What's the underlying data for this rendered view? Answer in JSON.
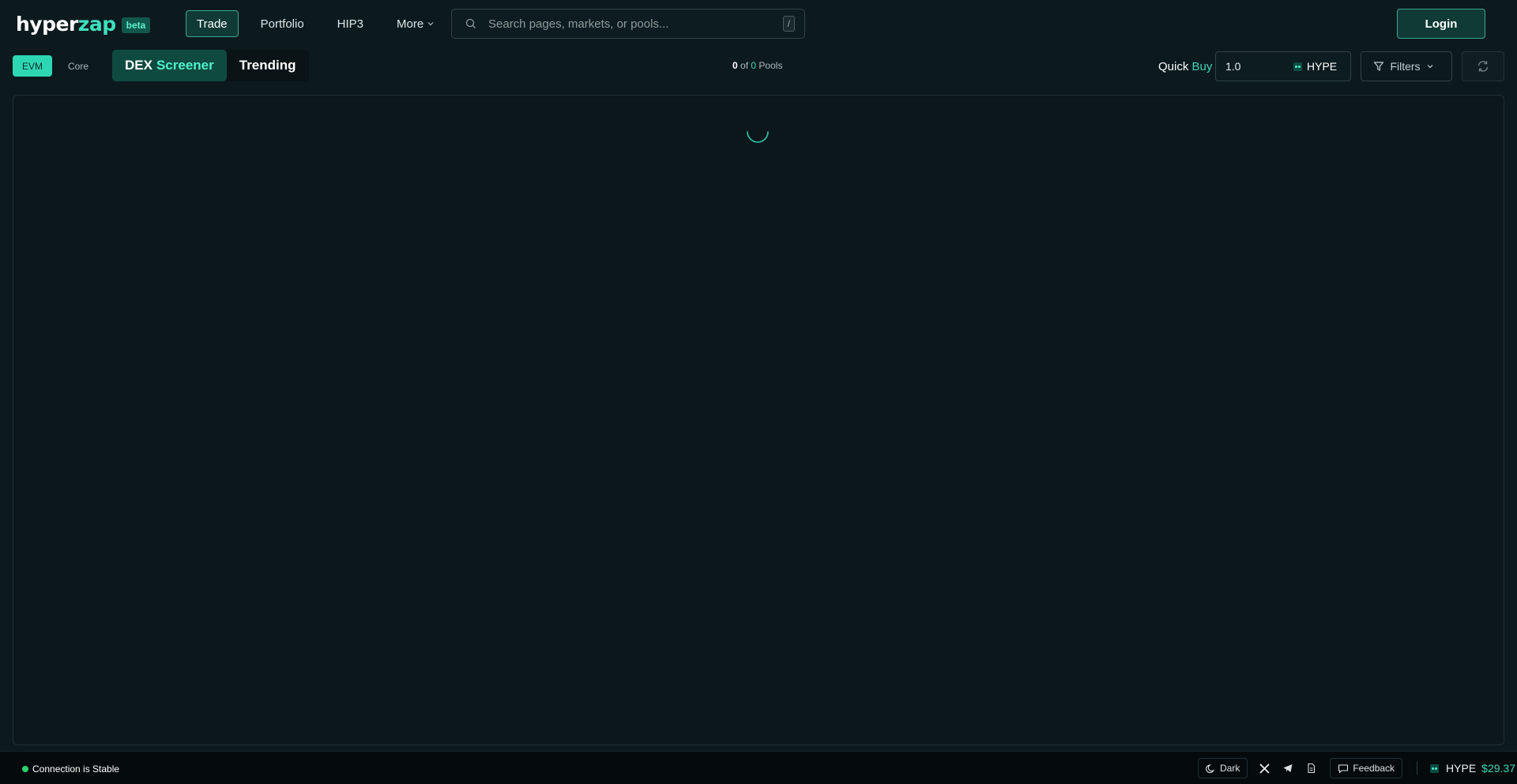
{
  "app": {
    "logo_main": "hyper",
    "logo_accent": "zap",
    "badge": "beta"
  },
  "nav": {
    "items": [
      {
        "label": "Trade",
        "active": true
      },
      {
        "label": "Portfolio"
      },
      {
        "label": "HIP3"
      },
      {
        "label": "More"
      }
    ]
  },
  "search": {
    "placeholder": "Search pages, markets, or pools...",
    "shortcut": "/"
  },
  "auth": {
    "login_label": "Login"
  },
  "chain_toggle": {
    "options": [
      {
        "label": "EVM",
        "active": true
      },
      {
        "label": "Core"
      }
    ]
  },
  "screener_tabs": {
    "dex_prefix": "DEX",
    "dex_suffix": "Screener",
    "trending": "Trending"
  },
  "pools": {
    "shown": "0",
    "of_label": "of",
    "total": "0",
    "unit": "Pools"
  },
  "quick_buy": {
    "label_main": "Quick",
    "label_accent": "Buy",
    "amount": "1.0",
    "token": "HYPE"
  },
  "filters": {
    "label": "Filters"
  },
  "footer": {
    "status": "Connection is Stable",
    "theme": "Dark",
    "feedback": "Feedback",
    "price_token": "HYPE",
    "price_value": "$29.37"
  },
  "colors": {
    "background": "#0c1a1e",
    "accent": "#3fd7b5",
    "status_ok": "#2bd26b"
  },
  "icons": [
    "search-icon",
    "chevron-down-icon",
    "filter-icon",
    "refresh-icon",
    "moon-icon",
    "x-logo-icon",
    "telegram-icon",
    "document-icon",
    "chat-icon",
    "hype-token-icon",
    "loading-spinner"
  ]
}
